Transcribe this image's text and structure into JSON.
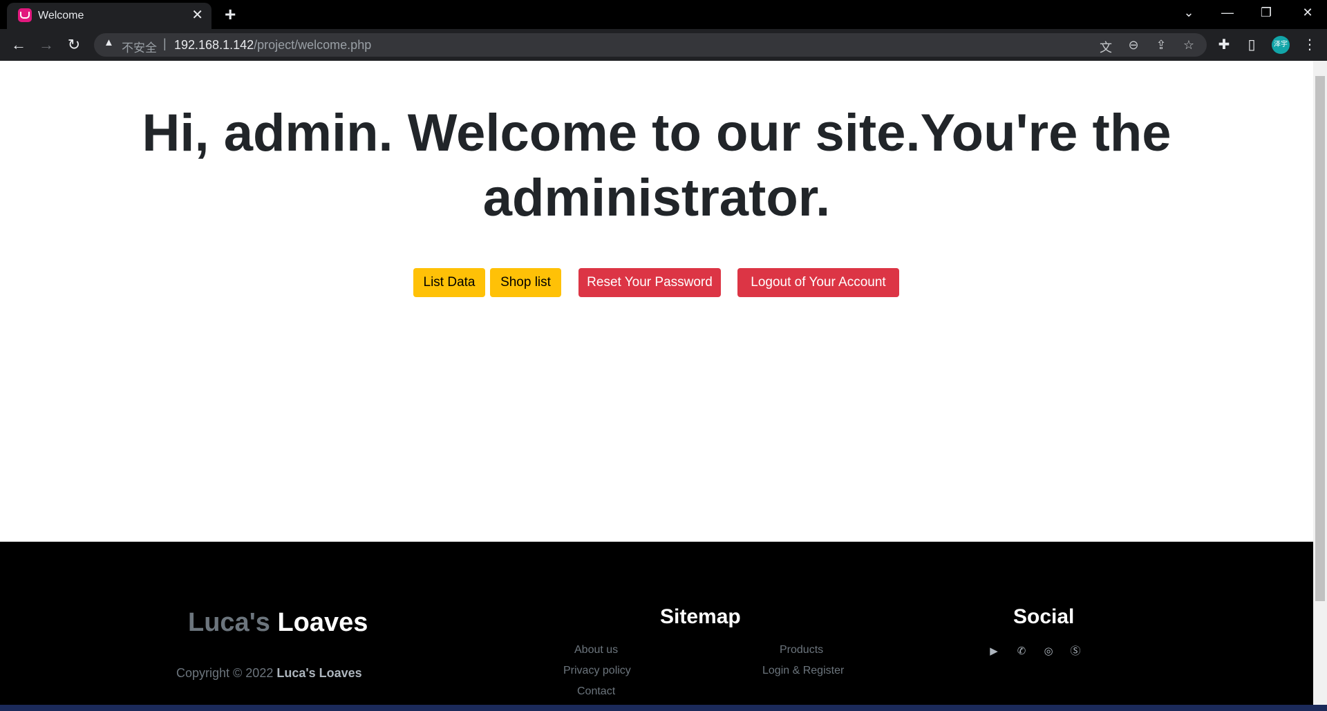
{
  "browser": {
    "tab_title": "Welcome",
    "tab_close": "✕",
    "new_tab": "+",
    "insecure_label": "不安全",
    "separator": "|",
    "url_host": "192.168.1.142",
    "url_path": "/project/welcome.php",
    "profile_initials": "泽宇"
  },
  "page": {
    "headline": "Hi, admin. Welcome to our site.You're the administrator.",
    "buttons": {
      "list_data": "List Data",
      "shop_list": "Shop list",
      "reset_password": "Reset Your Password",
      "logout": "Logout of Your Account"
    }
  },
  "footer": {
    "brand_first": "Luca's",
    "brand_second": "Loaves",
    "copyright_prefix": "Copyright © 2022",
    "copyright_brand": "Luca's Loaves",
    "sitemap_title": "Sitemap",
    "sitemap_links": {
      "about": "About us",
      "privacy": "Privacy policy",
      "contact": "Contact",
      "products": "Products",
      "login": "Login & Register"
    },
    "social_title": "Social"
  },
  "colors": {
    "warning": "#ffc107",
    "danger": "#dc3545",
    "footer_bg": "#000000"
  }
}
